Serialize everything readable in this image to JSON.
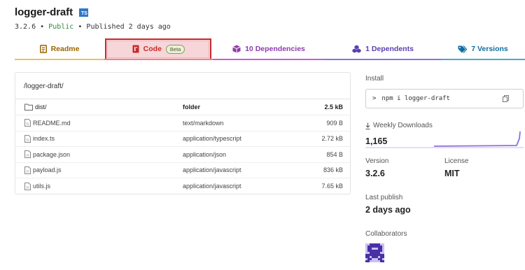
{
  "package": {
    "name": "logger-draft",
    "ts_badge": "TS",
    "version": "3.2.6",
    "sep1": "•",
    "visibility": "Public",
    "sep2": "•",
    "published": "Published 2 days ago"
  },
  "tabs": {
    "readme": "Readme",
    "code": "Code",
    "code_badge": "Beta",
    "dependencies": "10 Dependencies",
    "dependents": "1 Dependents",
    "versions": "7 Versions"
  },
  "files": {
    "path_prefix": "/",
    "path": "logger-draft",
    "path_suffix": "/",
    "rows": [
      {
        "name": "dist/",
        "type": "folder",
        "size": "2.5 kB"
      },
      {
        "name": "README.md",
        "type": "text/markdown",
        "size": "909 B"
      },
      {
        "name": "index.ts",
        "type": "application/typescript",
        "size": "2.72 kB"
      },
      {
        "name": "package.json",
        "type": "application/json",
        "size": "854 B"
      },
      {
        "name": "payload.js",
        "type": "application/javascript",
        "size": "836 kB"
      },
      {
        "name": "utils.js",
        "type": "application/javascript",
        "size": "7.65 kB"
      }
    ]
  },
  "sidebar": {
    "install_label": "Install",
    "install_prompt": ">",
    "install_command": "npm i logger-draft",
    "downloads_label": "Weekly Downloads",
    "downloads_value": "1,165",
    "version_label": "Version",
    "version_value": "3.2.6",
    "license_label": "License",
    "license_value": "MIT",
    "last_publish_label": "Last publish",
    "last_publish_value": "2 days ago",
    "collaborators_label": "Collaborators"
  },
  "colors": {
    "code_tab_highlight": "#f6d6d9",
    "code_tab_border": "#c52c2c",
    "ts_badge": "#3178c6",
    "public": "#2b8a3e",
    "sparkline": "#8c6fe0"
  }
}
